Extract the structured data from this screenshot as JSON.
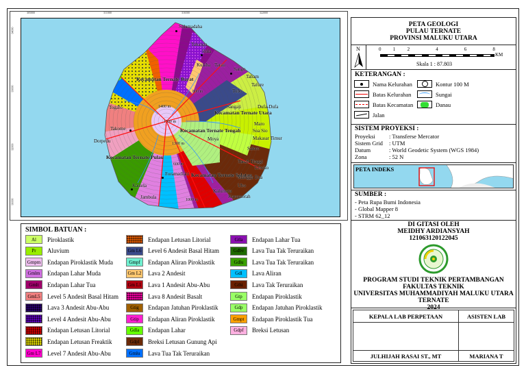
{
  "map": {
    "grid_x_labels": [
      "305000",
      "311000",
      "316500",
      "322000"
    ],
    "grid_y_labels": [
      "94000",
      "93000",
      "92000",
      "91000"
    ],
    "places": [
      "Sulamadaha",
      "Tabanga",
      "Bula",
      "Kulaba",
      "Tarau",
      "Sango",
      "Tabam",
      "Tafure",
      "Tubo",
      "Kecamatan Ternate Barat",
      "Kecamatan Ternate Utara",
      "Sangaji",
      "Dufa-Dufa",
      "Togafo",
      "Takome",
      "Dorpedu",
      "Kecamatan Ternate Tengah",
      "Maro",
      "Soa Sio",
      "Makasar Timur",
      "Salero",
      "Kecamatan Ternate Pulau",
      "Kecamatan Ternate Selatan",
      "Foramadiahi",
      "Kastela",
      "Jambula",
      "Kalumata",
      "Kayumerah",
      "Ubo",
      "Mangga Dua",
      "Toboko",
      "Moya",
      "Tanah Tinggi"
    ],
    "contours": [
      "1400 m",
      "1500 m",
      "1300 m",
      "800 m",
      "600 m",
      "1000 m"
    ]
  },
  "legend": {
    "title": "SIMBOL BATUAN :",
    "items": [
      {
        "code": "Al",
        "label": "Piroklastik",
        "color": "#ccff66"
      },
      {
        "code": "Pr",
        "label": "Aluvium",
        "color": "#99ee00"
      },
      {
        "code": "Gmpm",
        "label": "Endapan Piroklastik Muda",
        "color": "#f0c0f0"
      },
      {
        "code": "Gmlm",
        "label": "Endapan Lahar Muda",
        "color": "#d070e0"
      },
      {
        "code": "Gmlt",
        "label": "Endapan Lahar Tua",
        "color": "#a0006a"
      },
      {
        "code": "GmL5",
        "label": "Level 5 Andesit Basal Hitam",
        "color": "#f08080"
      },
      {
        "code": "",
        "label": "Lava 3 Andesit Abu-Abu",
        "color": "#2a0070"
      },
      {
        "code": "",
        "label": "Level 4 Andesit Abu-Abu",
        "color": "#6000c0"
      },
      {
        "code": "",
        "label": "Endapan Letusan Litorial",
        "color": "#e00000"
      },
      {
        "code": "",
        "label": "Endapan Letusan Freaktik",
        "color": "#e8e000"
      },
      {
        "code": "Gm L7",
        "label": "Level 7 Andesit Abu-Abu",
        "color": "#ff00cc"
      },
      {
        "code": "",
        "label": "Endapan Letusan Litorial",
        "color": "#f06000"
      },
      {
        "code": "Gm L6",
        "label": "Level 6 Andesit Basal Hitam",
        "color": "#3a4a8a"
      },
      {
        "code": "Gmpf",
        "label": "Endapan Aliran Piroklastik",
        "color": "#70f0d0"
      },
      {
        "code": "Gm L2",
        "label": "Lava 2 Andesit",
        "color": "#ffc870"
      },
      {
        "code": "Gm L1",
        "label": "Lava 1 Andesit Abu-Abu",
        "color": "#b00010"
      },
      {
        "code": "",
        "label": "Lava 8 Andesit Basalt",
        "color": "#ff00aa"
      },
      {
        "code": "Gtig",
        "label": "Endapan Jatuhan Piroklastik",
        "color": "#a06000"
      },
      {
        "code": "Gtip",
        "label": "Endapan Aliran Piroklastik",
        "color": "#ff20d0"
      },
      {
        "code": "Gdla",
        "label": "Endapan Lahar",
        "color": "#66ff00"
      },
      {
        "code": "Gdpl",
        "label": "Breksi Letusan Gunung Api",
        "color": "#6b2a08"
      },
      {
        "code": "Gmlu",
        "label": "Lava Tua Tak Teruraikan",
        "color": "#0070ff"
      },
      {
        "code": "Gtla",
        "label": "Endapan Lahar Tua",
        "color": "#8a10b0"
      },
      {
        "code": "Gdbv",
        "label": "Lava Tua Tak Teruraikan",
        "color": "#1e6a00"
      },
      {
        "code": "Gdlu",
        "label": "Lava Tua Tak Teruraikan",
        "color": "#3aa000"
      },
      {
        "code": "Gdl",
        "label": "Lava Aliran",
        "color": "#00c0ff"
      },
      {
        "code": "Gthi",
        "label": "Lava Tak Teruraikan",
        "color": "#6a2000"
      },
      {
        "code": "Gtp",
        "label": "Endapan Piroklastik",
        "color": "#99ff66"
      },
      {
        "code": "Gdp",
        "label": "Endapan Jatuhan Piroklastik",
        "color": "#99ff66"
      },
      {
        "code": "Gmpt",
        "label": "Endapan Piroklastik Tua",
        "color": "#ffa000"
      },
      {
        "code": "Gdpf",
        "label": "Breksi Letusan",
        "color": "#ffb0e0"
      }
    ]
  },
  "title": {
    "line1": "PETA GEOLOGI",
    "line2": "PULAU TERNATE",
    "line3": "PROVINSI MALUKU UTARA"
  },
  "scale": {
    "north": "N",
    "ticks": [
      "0",
      "1",
      "2",
      "4",
      "6",
      "8"
    ],
    "unit": "KM",
    "text": "Skala 1 : 87.803"
  },
  "keterangan": {
    "title": "KETERANGAN :",
    "items": [
      "Nama Kelurahan",
      "Kontur 100 M",
      "Batas Kelurahan",
      "Sungai",
      "Batas Kecamatan",
      "Danau",
      "Jalan"
    ]
  },
  "proyeksi": {
    "title": "SISTEM PROYEKSI :",
    "rows": [
      {
        "k": "Proyeksi",
        "v": ": Transferse Mercator"
      },
      {
        "k": "Sistem Grid",
        "v": ": UTM"
      },
      {
        "k": "Datum",
        "v": ": World Geodetic System (WGS 1984)"
      },
      {
        "k": "Zona",
        "v": ": 52 N"
      }
    ]
  },
  "indeks": {
    "title": "PETA INDEKS"
  },
  "sumber": {
    "title": "SUMBER :",
    "items": [
      "- Peta Rupa Bumi Indonesia",
      "- Global Mapper 8",
      "- STRM 62_12"
    ]
  },
  "credit": {
    "l1": "DI GITASI OLEH",
    "l2": "MEIDHY ARDIANSYAH",
    "l3": "121063120122045",
    "p1": "PROGRAM STUDI TEKNIK PERTAMBANGAN",
    "p2": "FAKULTAS TEKNIK",
    "p3": "UNIVERSITAS MUHAMMADIYAH MALUKU UTARA",
    "p4": "TERNATE",
    "p5": "2024"
  },
  "signatures": {
    "h1": "KEPALA LAB PERPETAAN",
    "h2": "ASISTEN LAB",
    "n1": "JULHIJAH RASAI ST., MT",
    "n2": "MARIANA T"
  }
}
